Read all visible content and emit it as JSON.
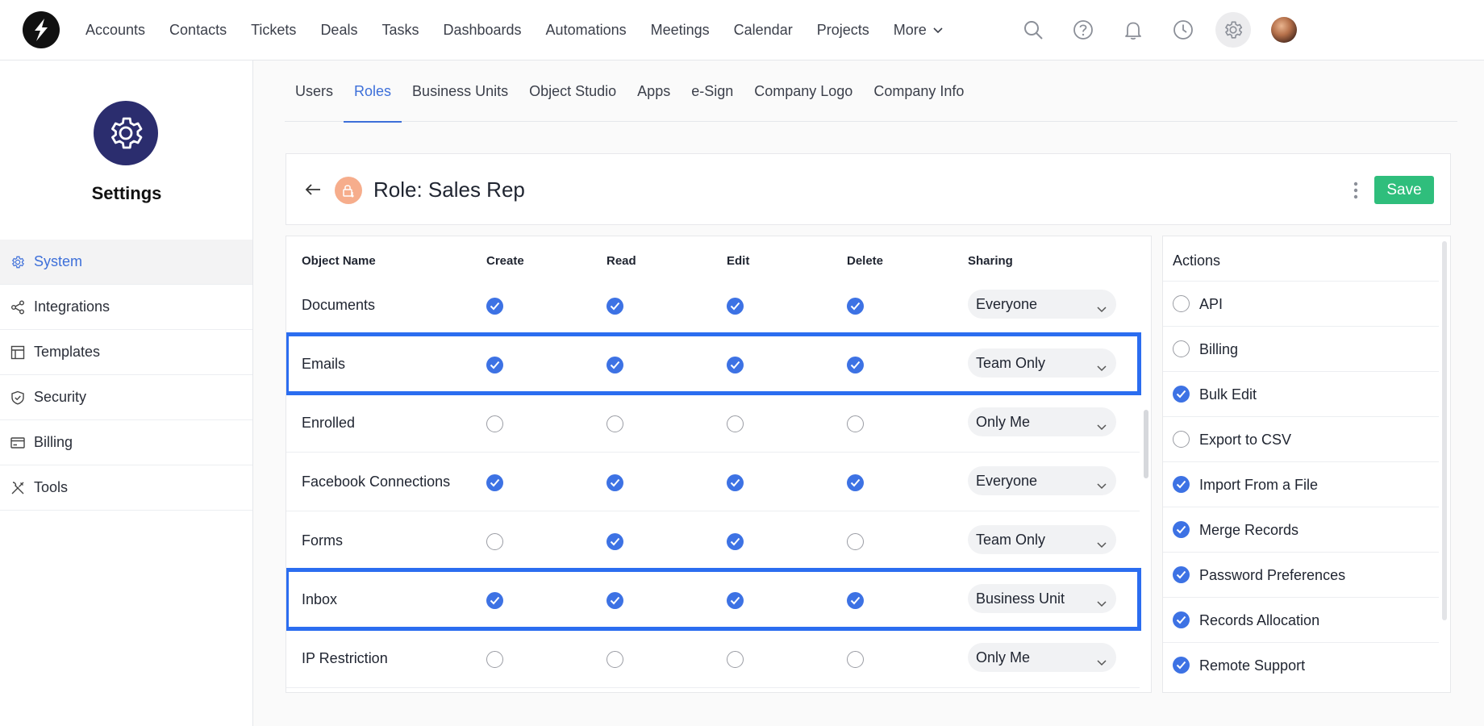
{
  "nav": {
    "items": [
      "Accounts",
      "Contacts",
      "Tickets",
      "Deals",
      "Tasks",
      "Dashboards",
      "Automations",
      "Meetings",
      "Calendar",
      "Projects"
    ],
    "more_label": "More"
  },
  "top_icons": [
    "search-icon",
    "help-icon",
    "bell-icon",
    "clock-icon",
    "gear-icon"
  ],
  "sidebar": {
    "title": "Settings",
    "items": [
      {
        "label": "System",
        "icon": "gear-icon",
        "active": true
      },
      {
        "label": "Integrations",
        "icon": "share-icon",
        "active": false
      },
      {
        "label": "Templates",
        "icon": "layout-icon",
        "active": false
      },
      {
        "label": "Security",
        "icon": "shield-icon",
        "active": false
      },
      {
        "label": "Billing",
        "icon": "card-icon",
        "active": false
      },
      {
        "label": "Tools",
        "icon": "tools-icon",
        "active": false
      }
    ]
  },
  "tabs": [
    {
      "label": "Users",
      "active": false
    },
    {
      "label": "Roles",
      "active": true
    },
    {
      "label": "Business Units",
      "active": false
    },
    {
      "label": "Object Studio",
      "active": false
    },
    {
      "label": "Apps",
      "active": false
    },
    {
      "label": "e-Sign",
      "active": false
    },
    {
      "label": "Company Logo",
      "active": false
    },
    {
      "label": "Company Info",
      "active": false
    }
  ],
  "role": {
    "title": "Role: Sales Rep",
    "save_label": "Save"
  },
  "permissions": {
    "headers": {
      "name": "Object Name",
      "create": "Create",
      "read": "Read",
      "edit": "Edit",
      "delete": "Delete",
      "sharing": "Sharing"
    },
    "rows": [
      {
        "name": "Documents",
        "create": true,
        "read": true,
        "edit": true,
        "delete": true,
        "sharing": "Everyone",
        "highlighted": false
      },
      {
        "name": "Emails",
        "create": true,
        "read": true,
        "edit": true,
        "delete": true,
        "sharing": "Team Only",
        "highlighted": true
      },
      {
        "name": "Enrolled",
        "create": false,
        "read": false,
        "edit": false,
        "delete": false,
        "sharing": "Only Me",
        "highlighted": false
      },
      {
        "name": "Facebook Connections",
        "create": true,
        "read": true,
        "edit": true,
        "delete": true,
        "sharing": "Everyone",
        "highlighted": false
      },
      {
        "name": "Forms",
        "create": false,
        "read": true,
        "edit": true,
        "delete": false,
        "sharing": "Team Only",
        "highlighted": false
      },
      {
        "name": "Inbox",
        "create": true,
        "read": true,
        "edit": true,
        "delete": true,
        "sharing": "Business Unit",
        "highlighted": true
      },
      {
        "name": "IP Restriction",
        "create": false,
        "read": false,
        "edit": false,
        "delete": false,
        "sharing": "Only Me",
        "highlighted": false
      }
    ]
  },
  "actions": {
    "title": "Actions",
    "items": [
      {
        "label": "API",
        "checked": false
      },
      {
        "label": "Billing",
        "checked": false
      },
      {
        "label": "Bulk Edit",
        "checked": true
      },
      {
        "label": "Export to CSV",
        "checked": false
      },
      {
        "label": "Import From a File",
        "checked": true
      },
      {
        "label": "Merge Records",
        "checked": true
      },
      {
        "label": "Password Preferences",
        "checked": true
      },
      {
        "label": "Records Allocation",
        "checked": true
      },
      {
        "label": "Remote Support",
        "checked": true
      }
    ]
  },
  "colors": {
    "accent": "#3d72e4",
    "save": "#2fbe7c",
    "highlight": "#2b6df0",
    "settings_badge": "#2b2d6e",
    "role_icon": "#f6ad8c"
  }
}
